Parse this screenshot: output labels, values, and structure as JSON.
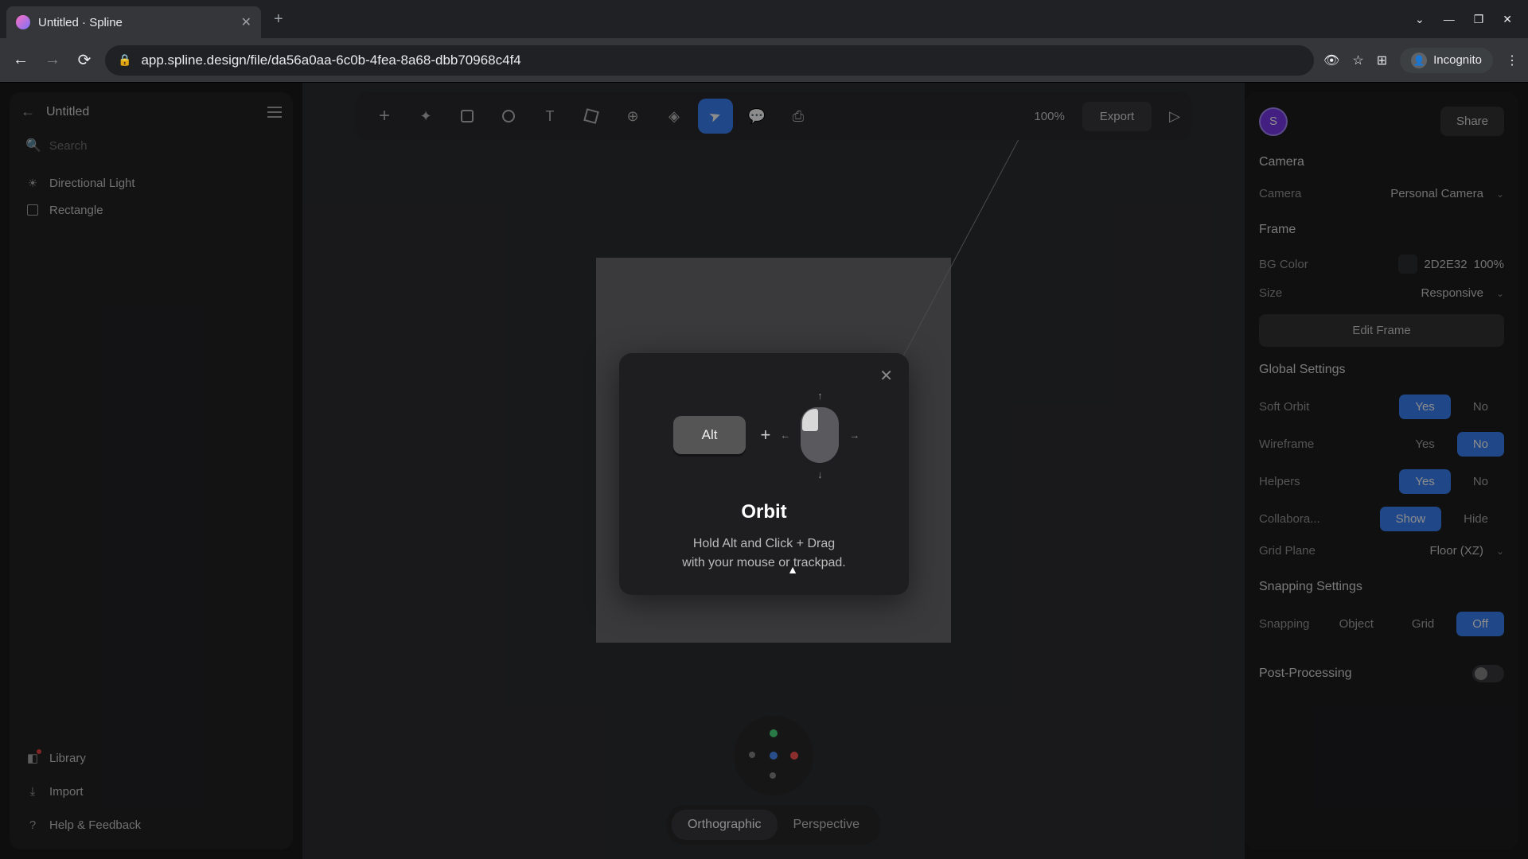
{
  "browser": {
    "tab_title": "Untitled · Spline",
    "url": "app.spline.design/file/da56a0aa-6c0b-4fea-8a68-dbb70968c4f4",
    "incognito_label": "Incognito"
  },
  "left_panel": {
    "doc_title": "Untitled",
    "search_placeholder": "Search",
    "layers": [
      {
        "name": "Directional Light",
        "icon": "light"
      },
      {
        "name": "Rectangle",
        "icon": "rect"
      }
    ],
    "footer": {
      "library": "Library",
      "import": "Import",
      "help": "Help & Feedback"
    }
  },
  "toolbar": {
    "zoom": "100%",
    "export": "Export"
  },
  "view_toggle": {
    "orthographic": "Orthographic",
    "perspective": "Perspective"
  },
  "modal": {
    "key_label": "Alt",
    "title": "Orbit",
    "desc_line1": "Hold Alt and Click + Drag",
    "desc_line2": "with your mouse or trackpad."
  },
  "right_panel": {
    "avatar_letter": "S",
    "share": "Share",
    "sections": {
      "camera": {
        "title": "Camera",
        "camera_label": "Camera",
        "camera_value": "Personal Camera"
      },
      "frame": {
        "title": "Frame",
        "bgcolor_label": "BG Color",
        "bgcolor_hex": "2D2E32",
        "bgcolor_alpha": "100%",
        "size_label": "Size",
        "size_value": "Responsive",
        "edit_button": "Edit Frame"
      },
      "global": {
        "title": "Global Settings",
        "soft_orbit": "Soft Orbit",
        "wireframe": "Wireframe",
        "helpers": "Helpers",
        "collaborative": "Collabora...",
        "grid_plane_label": "Grid Plane",
        "grid_plane_value": "Floor (XZ)",
        "yes": "Yes",
        "no": "No",
        "show": "Show",
        "hide": "Hide"
      },
      "snapping": {
        "title": "Snapping Settings",
        "snapping_label": "Snapping",
        "object": "Object",
        "grid": "Grid",
        "off": "Off"
      },
      "post": {
        "title": "Post-Processing"
      }
    }
  }
}
